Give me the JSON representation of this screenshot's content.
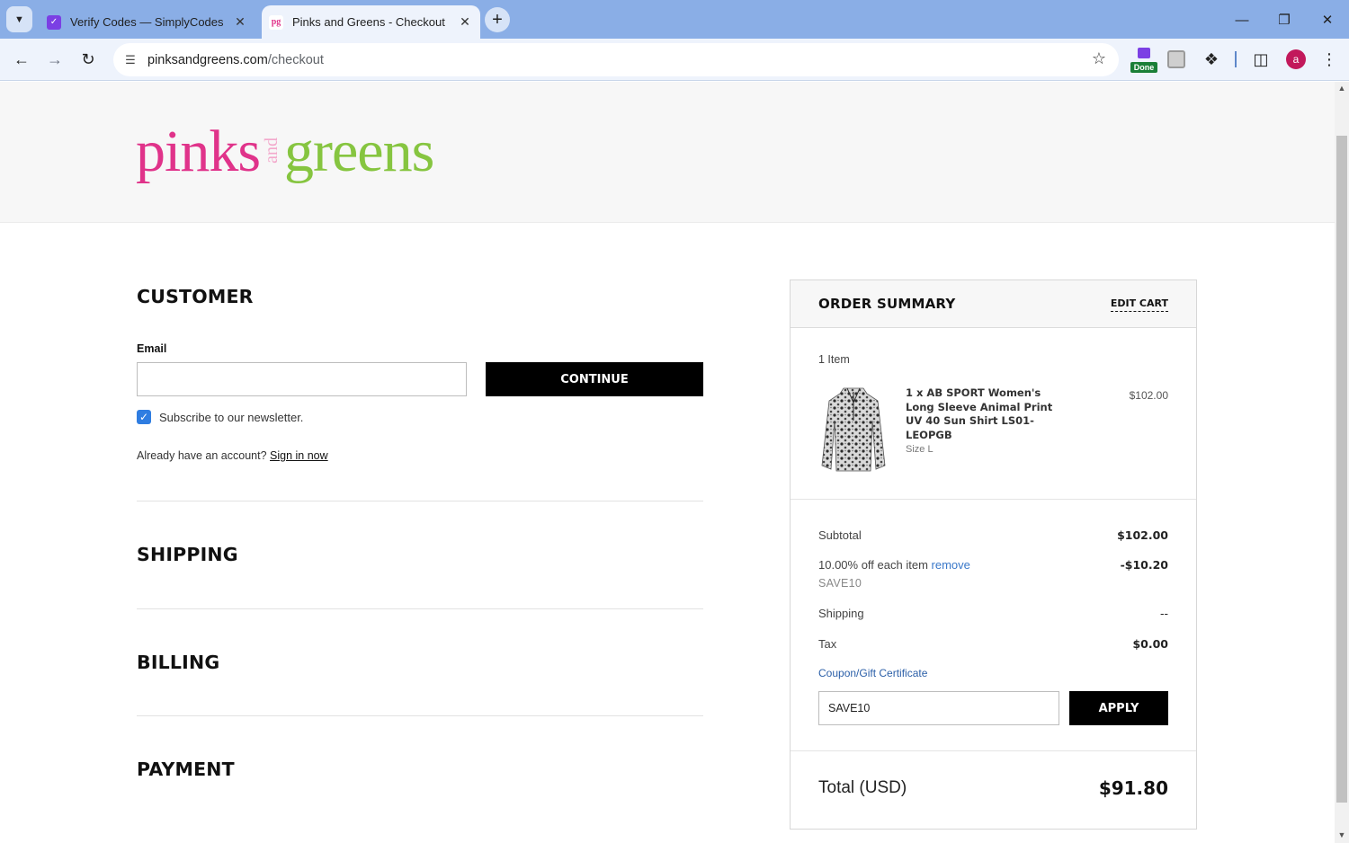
{
  "browser": {
    "tabs": [
      {
        "title": "Verify Codes — SimplyCodes",
        "favicon": "simplycodes-icon",
        "active": false
      },
      {
        "title": "Pinks and Greens - Checkout",
        "favicon": "pg-icon",
        "active": true
      }
    ],
    "url_host": "pinksandgreens.com",
    "url_path": "/checkout",
    "extension_badge": "Done",
    "profile_initial": "a"
  },
  "site": {
    "logo_pinks": "pinks",
    "logo_and": "and",
    "logo_greens": "greens"
  },
  "checkout": {
    "customer_title": "CUSTOMER",
    "email_label": "Email",
    "email_value": "",
    "continue_label": "CONTINUE",
    "newsletter_label": "Subscribe to our newsletter.",
    "newsletter_checked": true,
    "account_prompt": "Already have an account?",
    "sign_in_label": "Sign in now",
    "shipping_title": "SHIPPING",
    "billing_title": "BILLING",
    "payment_title": "PAYMENT"
  },
  "summary": {
    "title": "ORDER SUMMARY",
    "edit_cart_label": "EDIT CART",
    "item_count": "1 Item",
    "item": {
      "name": "1 x AB SPORT Women's Long Sleeve Animal Print UV 40 Sun Shirt LS01-LEOPGB",
      "price": "$102.00",
      "size": "Size L"
    },
    "subtotal_label": "Subtotal",
    "subtotal_value": "$102.00",
    "discount_label": "10.00% off each item",
    "discount_remove": "remove",
    "discount_value": "-$10.20",
    "discount_code": "SAVE10",
    "shipping_label": "Shipping",
    "shipping_value": "--",
    "tax_label": "Tax",
    "tax_value": "$0.00",
    "coupon_link": "Coupon/Gift Certificate",
    "coupon_value": "SAVE10",
    "apply_label": "APPLY",
    "total_label": "Total (USD)",
    "total_value": "$91.80"
  },
  "colors": {
    "brand_pink": "#e0338a",
    "brand_green": "#86c540",
    "link_blue": "#3a78c9",
    "checkbox_blue": "#2f7de1"
  }
}
